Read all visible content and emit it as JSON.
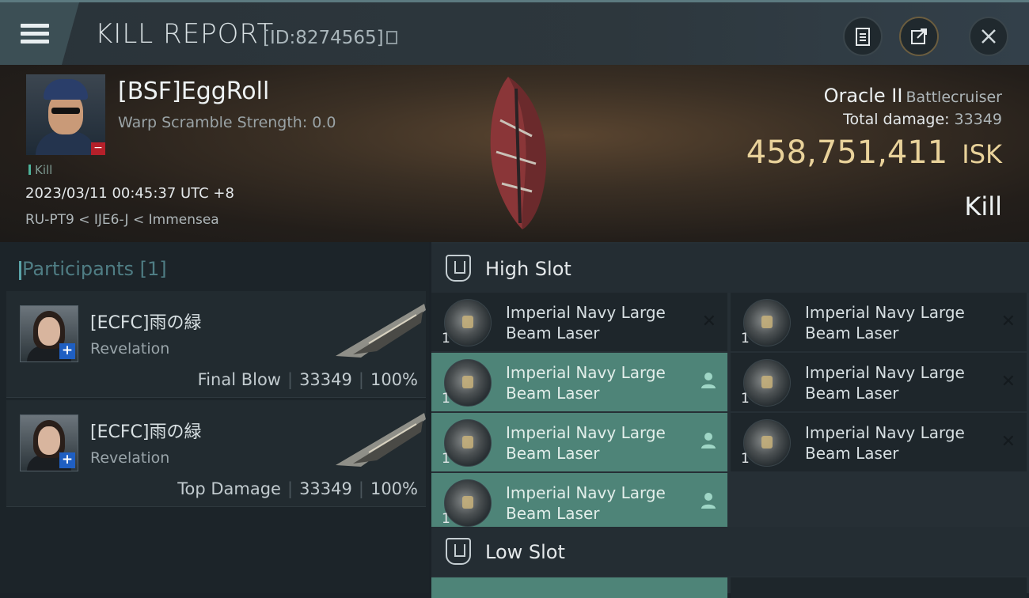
{
  "header": {
    "title": "KILL REPORT",
    "report_id": "[ID:8274565]"
  },
  "victim": {
    "name": "[BSF]EggRoll",
    "warp_scramble": "Warp Scramble Strength: 0.0",
    "tag": "Kill",
    "datetime": "2023/03/11 00:45:37 UTC +8",
    "location": "RU-PT9 < IJE6-J < Immensea",
    "ship": "Oracle II",
    "ship_class": "Battlecruiser",
    "total_damage_label": "Total damage:",
    "total_damage": "33349",
    "value": "458,751,411",
    "currency": "ISK",
    "result": "Kill"
  },
  "participants": {
    "header": "Participants [1]",
    "rows": [
      {
        "name": "[ECFC]雨の緑",
        "ship": "Revelation",
        "role": "Final Blow",
        "damage": "33349",
        "percent": "100%"
      },
      {
        "name": "[ECFC]雨の緑",
        "ship": "Revelation",
        "role": "Top Damage",
        "damage": "33349",
        "percent": "100%"
      }
    ]
  },
  "slots": {
    "high_title": "High Slot",
    "low_title": "Low Slot",
    "high_items": [
      {
        "qty": "1",
        "line1": "Imperial Navy Large",
        "line2": "Beam Laser",
        "status": "destroyed"
      },
      {
        "qty": "1",
        "line1": "Imperial Navy Large",
        "line2": "Beam Laser",
        "status": "destroyed"
      },
      {
        "qty": "1",
        "line1": "Imperial Navy Large",
        "line2": "Beam Laser",
        "status": "dropped"
      },
      {
        "qty": "1",
        "line1": "Imperial Navy Large",
        "line2": "Beam Laser",
        "status": "destroyed"
      },
      {
        "qty": "1",
        "line1": "Imperial Navy Large",
        "line2": "Beam Laser",
        "status": "dropped"
      },
      {
        "qty": "1",
        "line1": "Imperial Navy Large",
        "line2": "Beam Laser",
        "status": "destroyed"
      },
      {
        "qty": "1",
        "line1": "Imperial Navy Large",
        "line2": "Beam Laser",
        "status": "dropped"
      }
    ]
  },
  "icons": {
    "menu": "hamburger-menu-icon",
    "copy": "copy-icon",
    "clipboard": "clipboard-icon",
    "share": "share-icon",
    "close": "close-icon",
    "slot": "slot-icon"
  },
  "colors": {
    "isk_gold": "#e9d29a",
    "highlight_teal": "#4e8478",
    "minus_red": "#b5202a",
    "plus_blue": "#1f5fc2"
  }
}
